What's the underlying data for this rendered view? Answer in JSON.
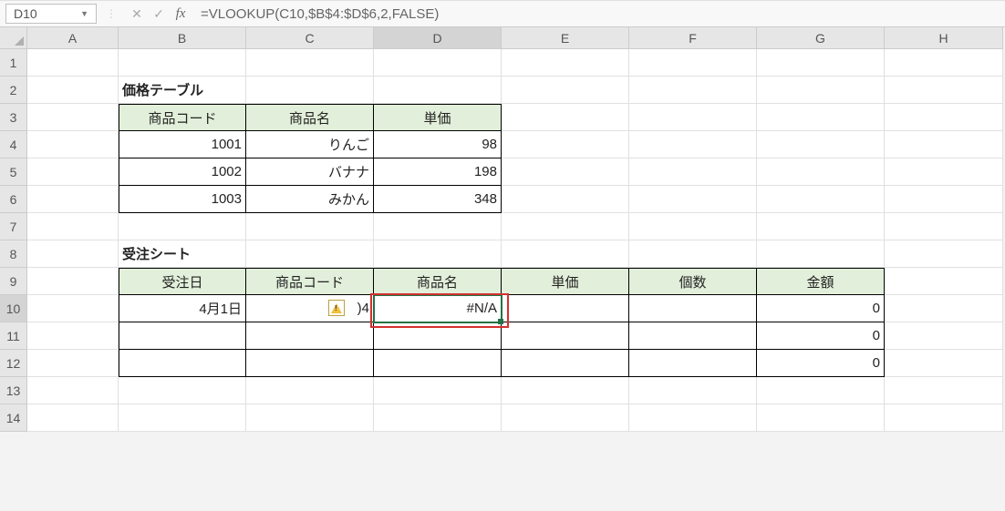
{
  "namebox": "D10",
  "formula": "=VLOOKUP(C10,$B$4:$D$6,2,FALSE)",
  "columns": [
    "A",
    "B",
    "C",
    "D",
    "E",
    "F",
    "G",
    "H"
  ],
  "rows": [
    "1",
    "2",
    "3",
    "4",
    "5",
    "6",
    "7",
    "8",
    "9",
    "10",
    "11",
    "12",
    "13",
    "14"
  ],
  "labels": {
    "price_table": "価格テーブル",
    "product_code": "商品コード",
    "product_name": "商品名",
    "unit_price": "単価",
    "order_sheet": "受注シート",
    "order_date": "受注日",
    "quantity": "個数",
    "amount": "金額"
  },
  "price_table": [
    {
      "code": "1001",
      "name": "りんご",
      "price": "98"
    },
    {
      "code": "1002",
      "name": "バナナ",
      "price": "198"
    },
    {
      "code": "1003",
      "name": "みかん",
      "price": "348"
    }
  ],
  "orders": [
    {
      "date": "4月1日",
      "code_visible": ")4",
      "name": "#N/A",
      "price": "",
      "qty": "",
      "amount": "0"
    },
    {
      "date": "",
      "code_visible": "",
      "name": "",
      "price": "",
      "qty": "",
      "amount": "0"
    },
    {
      "date": "",
      "code_visible": "",
      "name": "",
      "price": "",
      "qty": "",
      "amount": "0"
    }
  ],
  "active_col": "D",
  "active_row": "10"
}
